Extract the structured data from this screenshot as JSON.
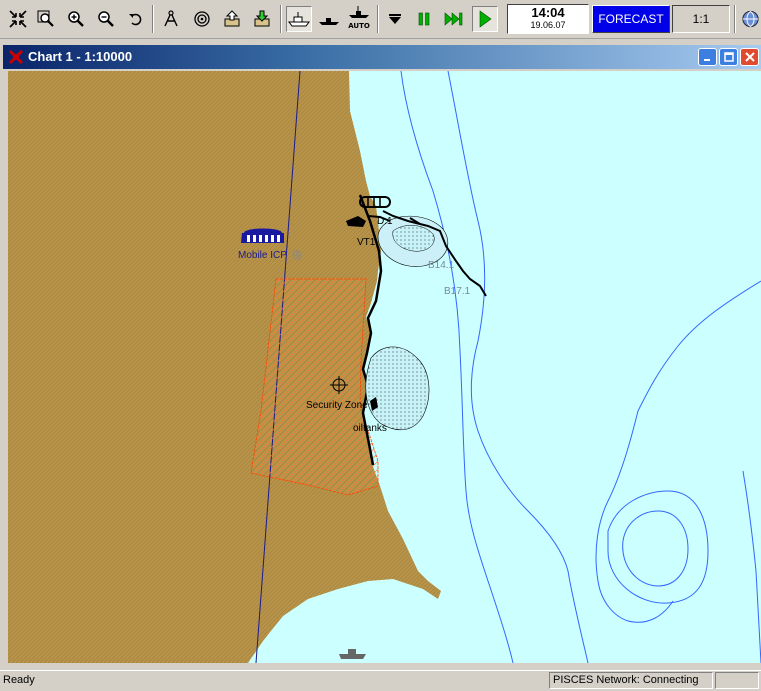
{
  "toolbar": {
    "buttons": [
      {
        "name": "fit-view-button",
        "icon": "arrows-in-icon"
      },
      {
        "name": "zoom-window-button",
        "icon": "magnifier-rect-icon"
      },
      {
        "name": "zoom-in-button",
        "icon": "zoom-in-icon"
      },
      {
        "name": "zoom-out-button",
        "icon": "zoom-out-icon"
      },
      {
        "name": "undo-view-button",
        "icon": "undo-icon"
      },
      {
        "name": "measure-button",
        "icon": "compass-icon"
      },
      {
        "name": "target-button",
        "icon": "target-icon"
      },
      {
        "name": "export-button",
        "icon": "box-up-icon"
      },
      {
        "name": "import-button",
        "icon": "box-down-icon"
      },
      {
        "name": "ship-mode-button",
        "icon": "ship-icon"
      },
      {
        "name": "vessel-button",
        "icon": "vessel-icon"
      },
      {
        "name": "auto-button",
        "icon": "auto-ship-icon"
      },
      {
        "name": "stop-button",
        "icon": "stop-icon"
      },
      {
        "name": "pause-button",
        "icon": "pause-icon"
      },
      {
        "name": "fast-forward-button",
        "icon": "fast-forward-icon"
      },
      {
        "name": "play-button",
        "icon": "play-icon"
      }
    ],
    "auto_label": "AUTO",
    "clock_time": "14:04",
    "clock_date": "19.06.07",
    "forecast_label": "FORECAST",
    "scale_label": "1:1"
  },
  "window": {
    "title": "Chart 1 - 1:10000"
  },
  "map": {
    "labels": {
      "mobile_icp": "Mobile ICP",
      "vt1": "VT1",
      "b14": "B14.1",
      "b17": "B17.1",
      "security_zone": "Security Zone",
      "oiltanks": "oiltanks",
      "partial_d": "D.1"
    },
    "colors": {
      "land": "#b8944a",
      "water": "#ccffff",
      "contour": "#3366ff",
      "security_zone": "#ff4400",
      "icp": "#2222aa"
    }
  },
  "status": {
    "left": "Ready",
    "network": "PISCES Network: Connecting"
  }
}
